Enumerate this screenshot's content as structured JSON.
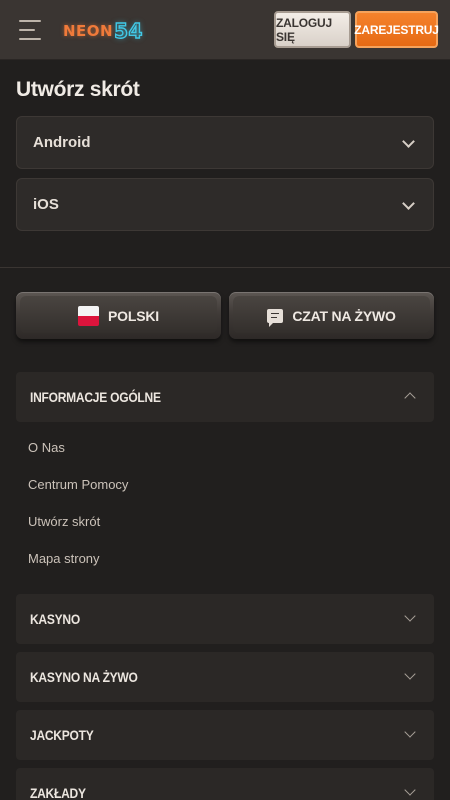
{
  "header": {
    "logo_text": "NEON",
    "logo_number": "54",
    "login_label": "ZALOGUJ SIĘ",
    "register_label": "ZAREJESTRUJ",
    "colors": {
      "brand_orange": "#f07a3a",
      "brand_cyan": "#41c8e6",
      "register_bg": "#ee7420"
    }
  },
  "shortcut": {
    "title": "Utwórz skrót",
    "options": [
      {
        "label": "Android"
      },
      {
        "label": "iOS"
      }
    ]
  },
  "footer_buttons": {
    "language_label": "POLSKI",
    "chat_label": "CZAT NA ŻYWO"
  },
  "accordion": {
    "sections": [
      {
        "label": "INFORMACJE OGÓLNE",
        "expanded": true,
        "links": [
          "O Nas",
          "Centrum Pomocy",
          "Utwórz skrót",
          "Mapa strony"
        ]
      },
      {
        "label": "KASYNO",
        "expanded": false
      },
      {
        "label": "KASYNO NA ŻYWO",
        "expanded": false
      },
      {
        "label": "JACKPOTY",
        "expanded": false
      },
      {
        "label": "ZAKŁADY",
        "expanded": false
      }
    ]
  },
  "icons": [
    "menu-icon",
    "poland-flag-icon",
    "chat-icon",
    "chevron-down-icon",
    "chevron-up-icon"
  ]
}
